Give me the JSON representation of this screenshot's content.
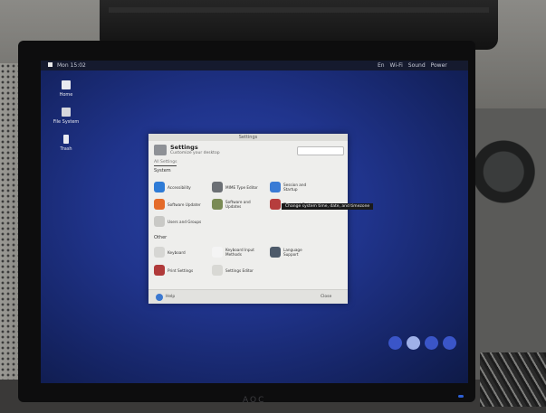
{
  "screen": {
    "topbar": {
      "clock": "Mon 15:02",
      "tray": [
        "En",
        "Wi-Fi",
        "Sound",
        "Power"
      ]
    },
    "desktop_icons": [
      {
        "label": "Home"
      },
      {
        "label": "File System"
      },
      {
        "label": "Trash"
      }
    ]
  },
  "settings_window": {
    "title": "Settings",
    "heading": "Settings",
    "subheading": "Customize your desktop",
    "tab": "All Settings",
    "sections": [
      {
        "name": "System",
        "items": [
          {
            "label": "Accessibility",
            "icon": "accessibility-icon",
            "color": "#2e7bd6"
          },
          {
            "label": "MIME Type Editor",
            "icon": "mime-editor-icon",
            "color": "#6b6f74"
          },
          {
            "label": "Session and Startup",
            "icon": "session-icon",
            "color": "#3a7bd5"
          },
          {
            "label": "Software Updater",
            "icon": "updater-icon",
            "color": "#e46b2a"
          },
          {
            "label": "Software and Updates",
            "icon": "software-icon",
            "color": "#7a8b55"
          },
          {
            "label": "Time and Date",
            "icon": "time-date-icon",
            "color": "#b63d3d"
          },
          {
            "label": "Users and Groups",
            "icon": "users-icon",
            "color": "#c9c9c6"
          }
        ]
      },
      {
        "name": "Other",
        "items": [
          {
            "label": "Keyboard",
            "icon": "keyboard-icon",
            "color": "#d6d6d3"
          },
          {
            "label": "Keyboard Input Methods",
            "icon": "input-methods-icon",
            "color": "#f4f4f4"
          },
          {
            "label": "Language Support",
            "icon": "language-icon",
            "color": "#4d5a6a"
          },
          {
            "label": "Print Settings",
            "icon": "printer-icon",
            "color": "#b03a3a"
          },
          {
            "label": "Settings Editor",
            "icon": "settings-editor-icon",
            "color": "#d8d8d4"
          }
        ]
      }
    ],
    "footer": {
      "help": "Help",
      "close": "Close"
    }
  },
  "tooltip": "Change system time, date, and timezone",
  "dock": {
    "colors": [
      "#3a55c8",
      "#9fb0e8",
      "#3a55c8",
      "#3a55c8"
    ]
  },
  "monitor_brand": "AOC"
}
